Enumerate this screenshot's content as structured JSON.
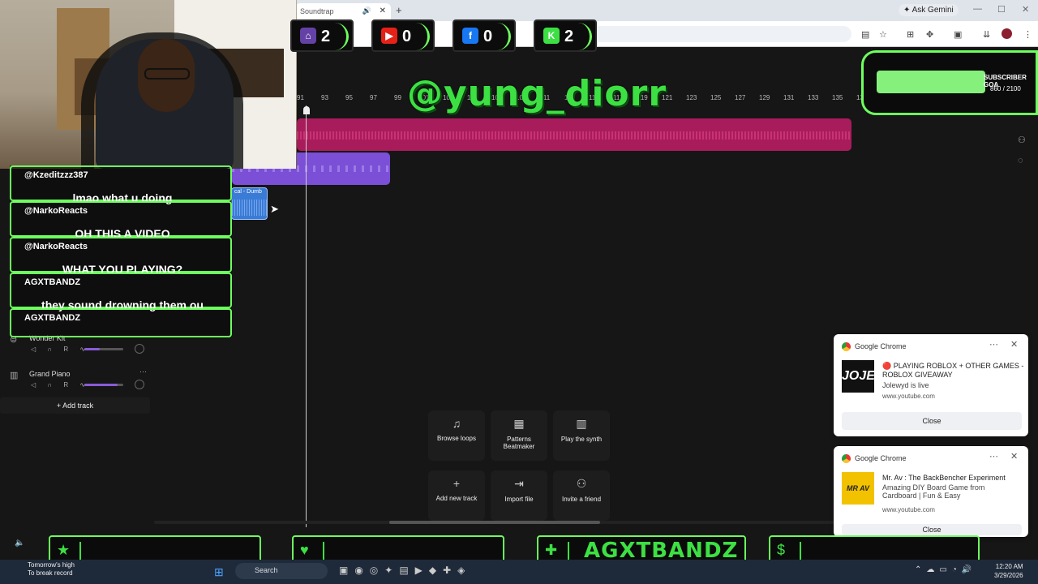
{
  "browser": {
    "tab_title": "Soundtrap",
    "ask_label": "Ask Gemini"
  },
  "stream": {
    "counters": [
      {
        "icon": "twitch-icon",
        "symbol": "⌂",
        "color": "#6441a5",
        "value": "2"
      },
      {
        "icon": "youtube-icon",
        "symbol": "▶",
        "color": "#e62117",
        "value": "0"
      },
      {
        "icon": "facebook-icon",
        "symbol": "f",
        "color": "#1877f2",
        "value": "0"
      },
      {
        "icon": "kick-icon",
        "symbol": "K",
        "color": "#3de043",
        "value": "2"
      }
    ],
    "handle": "@yung_diorr",
    "subscriber_goal": {
      "label": "SUBSCRIBER GOA",
      "count": "860 / 2100",
      "progress": 0.41
    },
    "chat": [
      {
        "user": "@Kzeditzzz387",
        "text": "lmao what u doing"
      },
      {
        "user": "@NarkoReacts",
        "text": "OH THIS A VIDEO"
      },
      {
        "user": "@NarkoReacts",
        "text": "WHAT YOU PLAYING?"
      },
      {
        "user": "AGXTBANDZ",
        "text": "they sound drowning them ou"
      },
      {
        "user": "AGXTBANDZ",
        "text": ""
      }
    ],
    "bottom_bars": [
      {
        "icon": "star-icon",
        "symbol": "★",
        "text": ""
      },
      {
        "icon": "heart-icon",
        "symbol": "♥",
        "text": ""
      },
      {
        "icon": "add-user-icon",
        "symbol": "👤",
        "text": "AGXTBANDZ"
      },
      {
        "icon": "dollar-icon",
        "symbol": "$",
        "text": ""
      }
    ]
  },
  "daw": {
    "ruler": [
      "91",
      "93",
      "95",
      "97",
      "99",
      "101",
      "103",
      "105",
      "107",
      "109",
      "111",
      "113",
      "115",
      "117",
      "119",
      "121",
      "123",
      "125",
      "127",
      "129",
      "131",
      "133",
      "135",
      "137"
    ],
    "clip_label": "cal - Dumb",
    "tracks": [
      {
        "name": "Wonder Kit",
        "volume": 0.4
      },
      {
        "name": "Grand Piano",
        "volume": 0.85
      }
    ],
    "add_track": "Add track",
    "actions": [
      {
        "icon": "music-note-icon",
        "symbol": "♫",
        "label": "Browse loops"
      },
      {
        "icon": "patterns-icon",
        "symbol": "▦",
        "label": "Patterns Beatmaker"
      },
      {
        "icon": "piano-icon",
        "symbol": "▥",
        "label": "Play the synth"
      },
      {
        "icon": "plus-icon",
        "symbol": "+",
        "label": "Add new track"
      },
      {
        "icon": "import-icon",
        "symbol": "⇥",
        "label": "Import file"
      },
      {
        "icon": "invite-icon",
        "symbol": "⚇",
        "label": "Invite a friend"
      }
    ]
  },
  "notifications": [
    {
      "app": "Google Chrome",
      "thumb": "JOJE",
      "title": "🔴 PLAYING ROBLOX + OTHER GAMES - ROBLOX GIVEAWAY",
      "subtitle": "Jolewyd is live",
      "url": "www.youtube.com",
      "close": "Close"
    },
    {
      "app": "Google Chrome",
      "thumb": "MR AV",
      "title": "Mr. Av : The BackBencher Experiment",
      "subtitle": "Amazing DIY Board Game from Cardboard | Fun & Easy",
      "url": "www.youtube.com",
      "close": "Close"
    }
  ],
  "taskbar": {
    "weather_line1": "Tomorrow's high",
    "weather_line2": "To break record",
    "search": "Search",
    "time": "12:20 AM",
    "date": "3/29/2026"
  }
}
